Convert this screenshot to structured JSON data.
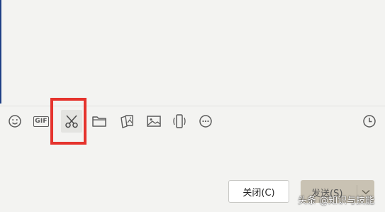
{
  "toolbar": {
    "icons": [
      {
        "name": "emoji-icon"
      },
      {
        "name": "gif-icon",
        "text": "GIF"
      },
      {
        "name": "scissors-icon"
      },
      {
        "name": "folder-icon"
      },
      {
        "name": "photo-album-icon"
      },
      {
        "name": "image-icon"
      },
      {
        "name": "shake-icon"
      },
      {
        "name": "more-icon"
      },
      {
        "name": "history-clock-icon"
      }
    ]
  },
  "actions": {
    "close_label": "关闭(C)",
    "send_label": "发送(S)"
  },
  "watermark": {
    "text": "头条 @知识与技能"
  },
  "colors": {
    "background": "#f3f3f1",
    "highlight": "#e5332d",
    "send_button": "#c9c2b3",
    "accent_edge": "#1e3f86"
  }
}
